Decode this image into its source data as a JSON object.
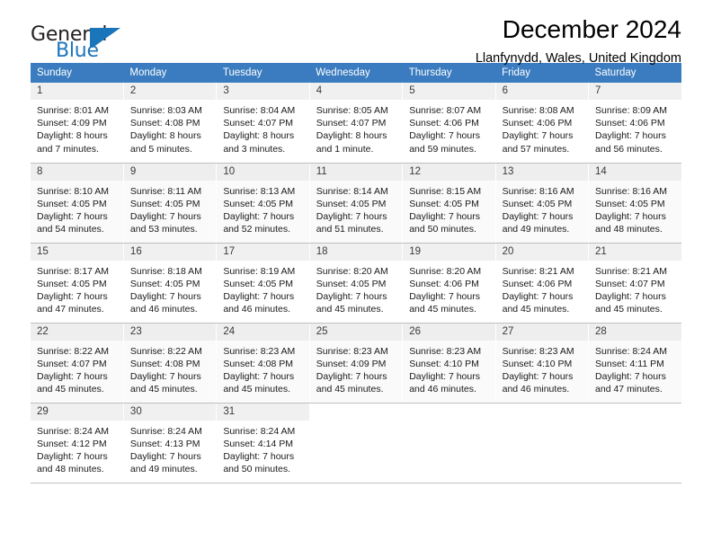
{
  "brand": {
    "name_part1": "General",
    "name_part2": "Blue",
    "accent_color": "#1b75bb"
  },
  "header": {
    "title": "December 2024",
    "subtitle": "Llanfynydd, Wales, United Kingdom"
  },
  "calendar": {
    "header_bg": "#3a7cbf",
    "weekdays": [
      "Sunday",
      "Monday",
      "Tuesday",
      "Wednesday",
      "Thursday",
      "Friday",
      "Saturday"
    ],
    "weeks": [
      [
        {
          "day": "1",
          "sunrise": "Sunrise: 8:01 AM",
          "sunset": "Sunset: 4:09 PM",
          "daylight_line1": "Daylight: 8 hours",
          "daylight_line2": "and 7 minutes."
        },
        {
          "day": "2",
          "sunrise": "Sunrise: 8:03 AM",
          "sunset": "Sunset: 4:08 PM",
          "daylight_line1": "Daylight: 8 hours",
          "daylight_line2": "and 5 minutes."
        },
        {
          "day": "3",
          "sunrise": "Sunrise: 8:04 AM",
          "sunset": "Sunset: 4:07 PM",
          "daylight_line1": "Daylight: 8 hours",
          "daylight_line2": "and 3 minutes."
        },
        {
          "day": "4",
          "sunrise": "Sunrise: 8:05 AM",
          "sunset": "Sunset: 4:07 PM",
          "daylight_line1": "Daylight: 8 hours",
          "daylight_line2": "and 1 minute."
        },
        {
          "day": "5",
          "sunrise": "Sunrise: 8:07 AM",
          "sunset": "Sunset: 4:06 PM",
          "daylight_line1": "Daylight: 7 hours",
          "daylight_line2": "and 59 minutes."
        },
        {
          "day": "6",
          "sunrise": "Sunrise: 8:08 AM",
          "sunset": "Sunset: 4:06 PM",
          "daylight_line1": "Daylight: 7 hours",
          "daylight_line2": "and 57 minutes."
        },
        {
          "day": "7",
          "sunrise": "Sunrise: 8:09 AM",
          "sunset": "Sunset: 4:06 PM",
          "daylight_line1": "Daylight: 7 hours",
          "daylight_line2": "and 56 minutes."
        }
      ],
      [
        {
          "day": "8",
          "sunrise": "Sunrise: 8:10 AM",
          "sunset": "Sunset: 4:05 PM",
          "daylight_line1": "Daylight: 7 hours",
          "daylight_line2": "and 54 minutes."
        },
        {
          "day": "9",
          "sunrise": "Sunrise: 8:11 AM",
          "sunset": "Sunset: 4:05 PM",
          "daylight_line1": "Daylight: 7 hours",
          "daylight_line2": "and 53 minutes."
        },
        {
          "day": "10",
          "sunrise": "Sunrise: 8:13 AM",
          "sunset": "Sunset: 4:05 PM",
          "daylight_line1": "Daylight: 7 hours",
          "daylight_line2": "and 52 minutes."
        },
        {
          "day": "11",
          "sunrise": "Sunrise: 8:14 AM",
          "sunset": "Sunset: 4:05 PM",
          "daylight_line1": "Daylight: 7 hours",
          "daylight_line2": "and 51 minutes."
        },
        {
          "day": "12",
          "sunrise": "Sunrise: 8:15 AM",
          "sunset": "Sunset: 4:05 PM",
          "daylight_line1": "Daylight: 7 hours",
          "daylight_line2": "and 50 minutes."
        },
        {
          "day": "13",
          "sunrise": "Sunrise: 8:16 AM",
          "sunset": "Sunset: 4:05 PM",
          "daylight_line1": "Daylight: 7 hours",
          "daylight_line2": "and 49 minutes."
        },
        {
          "day": "14",
          "sunrise": "Sunrise: 8:16 AM",
          "sunset": "Sunset: 4:05 PM",
          "daylight_line1": "Daylight: 7 hours",
          "daylight_line2": "and 48 minutes."
        }
      ],
      [
        {
          "day": "15",
          "sunrise": "Sunrise: 8:17 AM",
          "sunset": "Sunset: 4:05 PM",
          "daylight_line1": "Daylight: 7 hours",
          "daylight_line2": "and 47 minutes."
        },
        {
          "day": "16",
          "sunrise": "Sunrise: 8:18 AM",
          "sunset": "Sunset: 4:05 PM",
          "daylight_line1": "Daylight: 7 hours",
          "daylight_line2": "and 46 minutes."
        },
        {
          "day": "17",
          "sunrise": "Sunrise: 8:19 AM",
          "sunset": "Sunset: 4:05 PM",
          "daylight_line1": "Daylight: 7 hours",
          "daylight_line2": "and 46 minutes."
        },
        {
          "day": "18",
          "sunrise": "Sunrise: 8:20 AM",
          "sunset": "Sunset: 4:05 PM",
          "daylight_line1": "Daylight: 7 hours",
          "daylight_line2": "and 45 minutes."
        },
        {
          "day": "19",
          "sunrise": "Sunrise: 8:20 AM",
          "sunset": "Sunset: 4:06 PM",
          "daylight_line1": "Daylight: 7 hours",
          "daylight_line2": "and 45 minutes."
        },
        {
          "day": "20",
          "sunrise": "Sunrise: 8:21 AM",
          "sunset": "Sunset: 4:06 PM",
          "daylight_line1": "Daylight: 7 hours",
          "daylight_line2": "and 45 minutes."
        },
        {
          "day": "21",
          "sunrise": "Sunrise: 8:21 AM",
          "sunset": "Sunset: 4:07 PM",
          "daylight_line1": "Daylight: 7 hours",
          "daylight_line2": "and 45 minutes."
        }
      ],
      [
        {
          "day": "22",
          "sunrise": "Sunrise: 8:22 AM",
          "sunset": "Sunset: 4:07 PM",
          "daylight_line1": "Daylight: 7 hours",
          "daylight_line2": "and 45 minutes."
        },
        {
          "day": "23",
          "sunrise": "Sunrise: 8:22 AM",
          "sunset": "Sunset: 4:08 PM",
          "daylight_line1": "Daylight: 7 hours",
          "daylight_line2": "and 45 minutes."
        },
        {
          "day": "24",
          "sunrise": "Sunrise: 8:23 AM",
          "sunset": "Sunset: 4:08 PM",
          "daylight_line1": "Daylight: 7 hours",
          "daylight_line2": "and 45 minutes."
        },
        {
          "day": "25",
          "sunrise": "Sunrise: 8:23 AM",
          "sunset": "Sunset: 4:09 PM",
          "daylight_line1": "Daylight: 7 hours",
          "daylight_line2": "and 45 minutes."
        },
        {
          "day": "26",
          "sunrise": "Sunrise: 8:23 AM",
          "sunset": "Sunset: 4:10 PM",
          "daylight_line1": "Daylight: 7 hours",
          "daylight_line2": "and 46 minutes."
        },
        {
          "day": "27",
          "sunrise": "Sunrise: 8:23 AM",
          "sunset": "Sunset: 4:10 PM",
          "daylight_line1": "Daylight: 7 hours",
          "daylight_line2": "and 46 minutes."
        },
        {
          "day": "28",
          "sunrise": "Sunrise: 8:24 AM",
          "sunset": "Sunset: 4:11 PM",
          "daylight_line1": "Daylight: 7 hours",
          "daylight_line2": "and 47 minutes."
        }
      ],
      [
        {
          "day": "29",
          "sunrise": "Sunrise: 8:24 AM",
          "sunset": "Sunset: 4:12 PM",
          "daylight_line1": "Daylight: 7 hours",
          "daylight_line2": "and 48 minutes."
        },
        {
          "day": "30",
          "sunrise": "Sunrise: 8:24 AM",
          "sunset": "Sunset: 4:13 PM",
          "daylight_line1": "Daylight: 7 hours",
          "daylight_line2": "and 49 minutes."
        },
        {
          "day": "31",
          "sunrise": "Sunrise: 8:24 AM",
          "sunset": "Sunset: 4:14 PM",
          "daylight_line1": "Daylight: 7 hours",
          "daylight_line2": "and 50 minutes."
        },
        null,
        null,
        null,
        null
      ]
    ]
  }
}
